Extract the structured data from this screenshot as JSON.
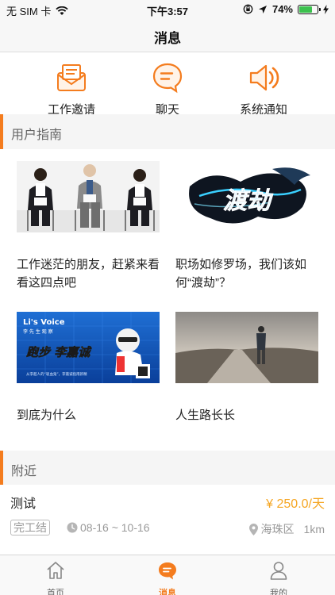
{
  "status_bar": {
    "carrier": "无 SIM 卡",
    "time": "下午3:57",
    "battery": "74%",
    "battery_level": 0.74
  },
  "nav": {
    "title": "消息"
  },
  "quick_actions": [
    {
      "label": "工作邀请",
      "icon": "envelope-icon"
    },
    {
      "label": "聊天",
      "icon": "chat-bubble-icon"
    },
    {
      "label": "系统通知",
      "icon": "speaker-icon"
    }
  ],
  "guide_section": {
    "title": "用户指南",
    "cards": [
      {
        "caption": "工作迷茫的朋友，赶紧来看看这四点吧",
        "image": "people-waiting-interview-photo"
      },
      {
        "caption": "职场如修罗场，我们该如何“渡劫”？",
        "image": "dragon-calligraphy-poster"
      },
      {
        "caption": "到底为什么",
        "image": "lis-voice-banner"
      },
      {
        "caption": "人生路长长",
        "image": "man-on-road-photo"
      }
    ],
    "banner_texts": {
      "dragon": "渡劫",
      "voice_title": "Li's Voice",
      "voice_sub": "李 先 生 观 察",
      "voice_main": "跑步 李嘉诚",
      "voice_foot": "从李超人的“吸血鬼”，李嘉诚指南新精"
    }
  },
  "nearby_section": {
    "title": "附近",
    "job": {
      "title": "测试",
      "salary": "¥ 250.0/天",
      "tag": "完工结",
      "date_range": "08-16 ~ 10-16",
      "district": "海珠区",
      "distance": "1km"
    }
  },
  "tab_bar": {
    "tabs": [
      {
        "label": "首页",
        "icon": "home-icon",
        "active": false
      },
      {
        "label": "消息",
        "icon": "message-bubble-icon",
        "active": true
      },
      {
        "label": "我的",
        "icon": "person-icon",
        "active": false
      }
    ]
  },
  "colors": {
    "accent": "#f47c1e",
    "salary": "#f5a623",
    "section_bg": "#f5f5f5"
  }
}
